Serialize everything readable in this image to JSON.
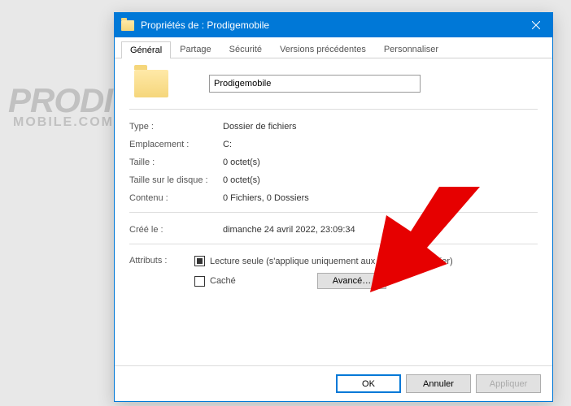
{
  "titlebar": {
    "text": "Propriétés de : Prodigemobile"
  },
  "tabs": {
    "general": "Général",
    "partage": "Partage",
    "securite": "Sécurité",
    "versions": "Versions précédentes",
    "personnaliser": "Personnaliser"
  },
  "name_input": {
    "value": "Prodigemobile"
  },
  "props": {
    "type_label": "Type :",
    "type_value": "Dossier de fichiers",
    "emplacement_label": "Emplacement :",
    "emplacement_value": "C:",
    "taille_label": "Taille :",
    "taille_value": "0 octet(s)",
    "taille_disque_label": "Taille sur le disque :",
    "taille_disque_value": "0 octet(s)",
    "contenu_label": "Contenu :",
    "contenu_value": "0 Fichiers, 0 Dossiers",
    "cree_label": "Créé le :",
    "cree_value": "dimanche 24 avril 2022, 23:09:34"
  },
  "attributs": {
    "label": "Attributs :",
    "lecture_seule": "Lecture seule (s'applique uniquement aux fichiers du dossier)",
    "cache": "Caché",
    "avance": "Avancé…"
  },
  "footer": {
    "ok": "OK",
    "annuler": "Annuler",
    "appliquer": "Appliquer"
  },
  "watermark": {
    "line1": "PRODIGE",
    "line2": "MOBILE.COM"
  }
}
